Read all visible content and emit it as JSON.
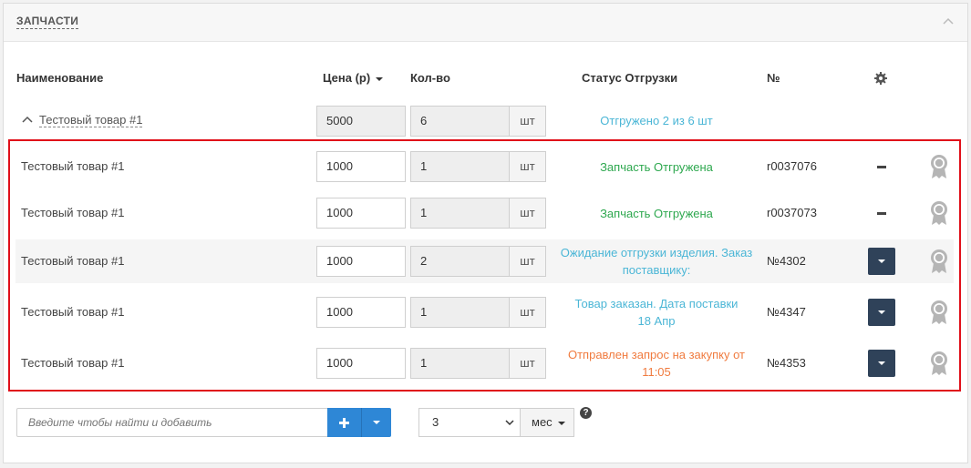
{
  "panel": {
    "title": "ЗАПЧАСТИ"
  },
  "columns": {
    "name": "Наименование",
    "price": "Цена (р)",
    "qty": "Кол-во",
    "status": "Статус Отгрузки",
    "num": "№"
  },
  "group": {
    "name": "Тестовый товар #1",
    "price": "5000",
    "qty": "6",
    "unit": "шт",
    "status": "Отгружено 2 из 6 шт",
    "status_color": "#4bb6d6"
  },
  "rows": [
    {
      "name": "Тестовый товар #1",
      "price": "1000",
      "qty": "1",
      "unit": "шт",
      "status_lines": [
        "Запчасть Отгружена"
      ],
      "status_color": "#2ea84f",
      "num": "r0037076",
      "action": "minus"
    },
    {
      "name": "Тестовый товар #1",
      "price": "1000",
      "qty": "1",
      "unit": "шт",
      "status_lines": [
        "Запчасть Отгружена"
      ],
      "status_color": "#2ea84f",
      "num": "r0037073",
      "action": "minus"
    },
    {
      "name": "Тестовый товар #1",
      "price": "1000",
      "qty": "2",
      "unit": "шт",
      "status_lines": [
        "Ожидание отгрузки изделия. Заказ",
        "поставщику:"
      ],
      "status_color": "#4bb6d6",
      "num": "№4302",
      "action": "dropdown"
    },
    {
      "name": "Тестовый товар #1",
      "price": "1000",
      "qty": "1",
      "unit": "шт",
      "status_lines": [
        "Товар заказан. Дата поставки",
        "18 Апр"
      ],
      "status_color": "#4bb6d6",
      "num": "№4347",
      "action": "dropdown"
    },
    {
      "name": "Тестовый товар #1",
      "price": "1000",
      "qty": "1",
      "unit": "шт",
      "status_lines": [
        "Отправлен запрос на закупку от",
        "11:05"
      ],
      "status_color": "#f07b3f",
      "num": "№4353",
      "action": "dropdown"
    }
  ],
  "footer": {
    "search_placeholder": "Введите чтобы найти и добавить",
    "period_value": "3",
    "period_unit": "мес",
    "help": "?"
  },
  "icons": {
    "collapse": "chevron-up-icon",
    "settings": "gear-icon",
    "expand": "chevron-up-icon",
    "award": "award-icon",
    "add": "plus-icon"
  }
}
